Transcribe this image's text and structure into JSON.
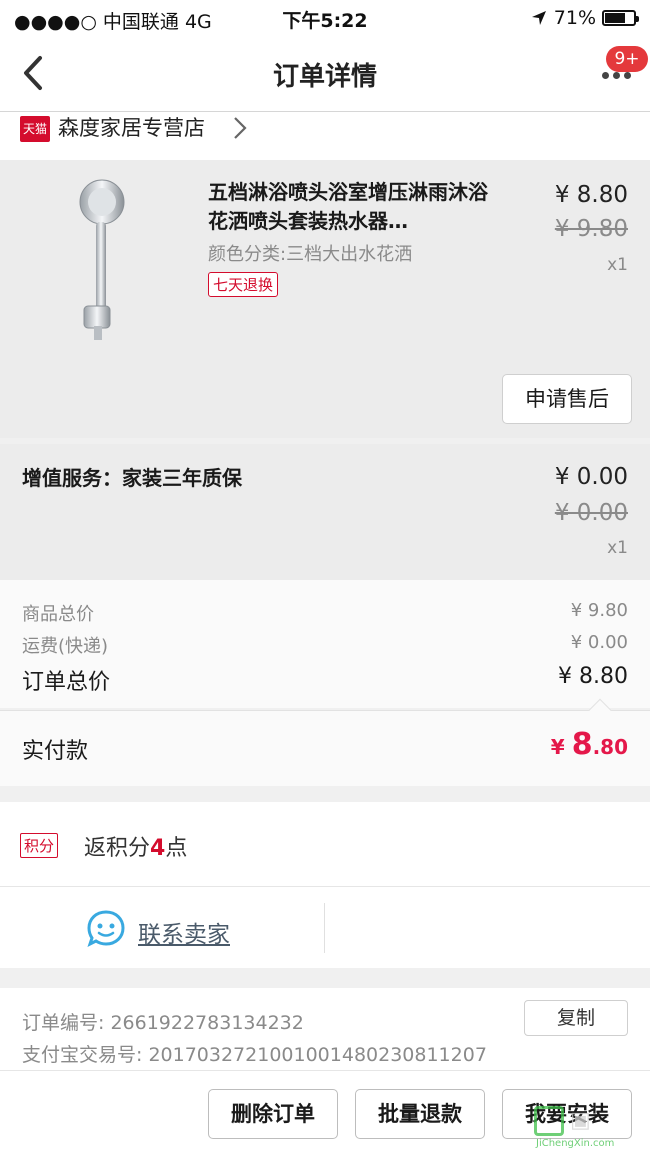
{
  "status_bar": {
    "carrier": "●●●●○ 中国联通   4G",
    "time": "下午5:22",
    "battery": "71%"
  },
  "nav": {
    "title": "订单详情",
    "badge": "9+"
  },
  "shop": {
    "tmall_label": "天猫",
    "name": "森度家居专营店"
  },
  "product": {
    "title": "五档淋浴喷头浴室增压淋雨沐浴花洒喷头套装热水器…",
    "sku": "颜色分类:三档大出水花洒",
    "tag": "七天退换",
    "price": "¥ 8.80",
    "original_price": "¥ 9.80",
    "quantity": "x1",
    "after_sale_button": "申请售后"
  },
  "service": {
    "label": "增值服务：家装三年质保",
    "price": "¥ 0.00",
    "original_price": "¥ 0.00",
    "quantity": "x1"
  },
  "totals": {
    "goods_label": "商品总价",
    "goods_value": "¥ 9.80",
    "shipping_label": "运费(快递)",
    "shipping_value": "¥ 0.00",
    "order_total_label": "订单总价",
    "order_total_value": "¥ 8.80",
    "paid_label": "实付款",
    "paid_currency": "¥ ",
    "paid_int": "8",
    "paid_dec": ".80"
  },
  "points": {
    "badge": "积分",
    "prefix": "返积分",
    "count": "4",
    "suffix": "点"
  },
  "contact": {
    "label": "联系卖家"
  },
  "order_info": {
    "order_no": "订单编号:   2661922783134232",
    "alipay_no": "支付宝交易号:   2017032721001001480230811207",
    "copy_button": "复制"
  },
  "actions": {
    "delete": "删除订单",
    "batch_refund": "批量退款",
    "install": "我要安装"
  },
  "watermark": {
    "site": "JiChengXin.com"
  },
  "colors": {
    "accent_red": "#e4184a",
    "tmall_red": "#d40c2d",
    "badge_red": "#e4393c",
    "contact_blue": "#39a9e0",
    "watermark_green": "#3fbf4a"
  }
}
